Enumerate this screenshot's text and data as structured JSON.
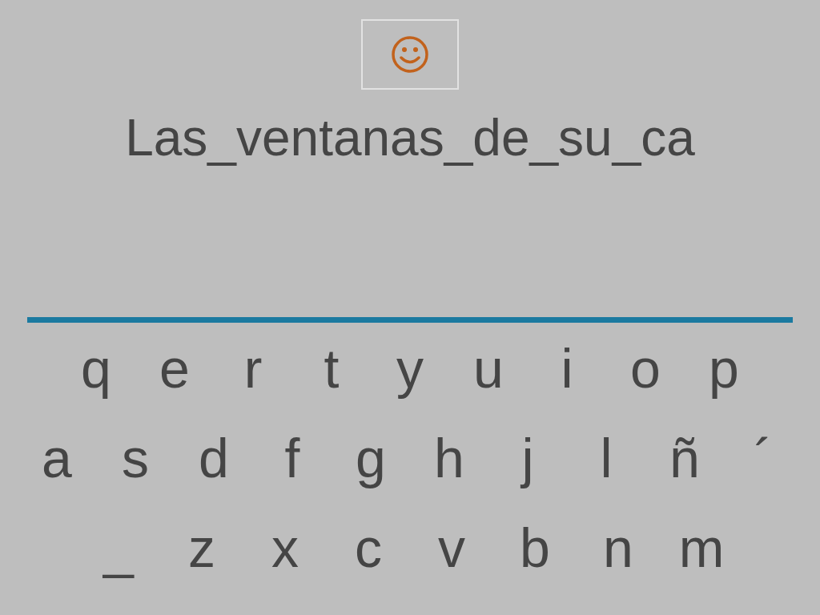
{
  "sentence": "Las_ventanas_de_su_ca",
  "keyboard": {
    "rows": [
      [
        "q",
        "e",
        "r",
        "t",
        "y",
        "u",
        "i",
        "o",
        "p"
      ],
      [
        "a",
        "s",
        "d",
        "f",
        "g",
        "h",
        "j",
        "l",
        "ñ",
        "´"
      ],
      [
        "_",
        "z",
        "x",
        "c",
        "v",
        "b",
        "n",
        "m"
      ]
    ]
  }
}
